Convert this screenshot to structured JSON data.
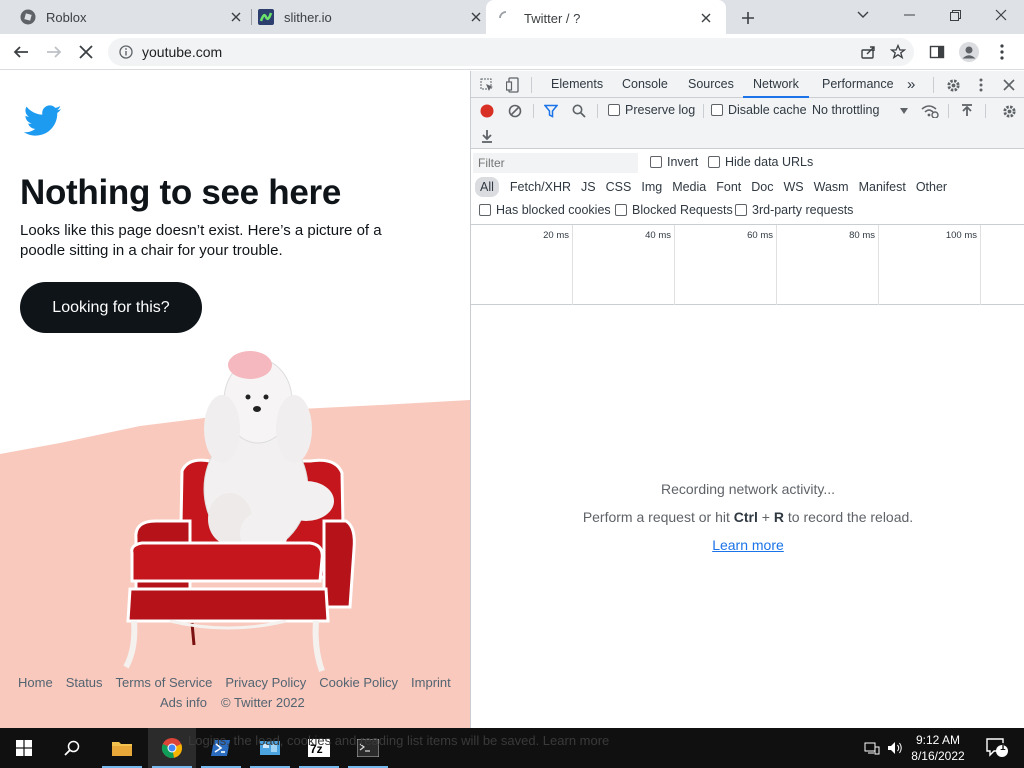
{
  "browser": {
    "tabs": [
      {
        "title": "Roblox",
        "icon": "roblox-icon"
      },
      {
        "title": "slither.io",
        "icon": "slither-icon"
      },
      {
        "title": "Twitter / ?",
        "icon": "loading-spinner-icon",
        "active": true
      }
    ],
    "address_bar": {
      "url": "youtube.com"
    }
  },
  "page": {
    "headline": "Nothing to see here",
    "subtext": "Looks like this page doesn’t exist. Here’s a picture of a poodle sitting in a chair for your trouble.",
    "cta_label": "Looking for this?",
    "footer_links": [
      "Home",
      "Status",
      "Terms of Service",
      "Privacy Policy",
      "Cookie Policy",
      "Imprint"
    ],
    "footer_links_row2": [
      "Ads info"
    ],
    "copyright": "© Twitter 2022",
    "colors": {
      "brand_blue": "#1d9bf0",
      "pink": "#f9c9bd",
      "chair_red": "#c4161c"
    }
  },
  "devtools": {
    "tabs": [
      "Elements",
      "Console",
      "Sources",
      "Network",
      "Performance"
    ],
    "active_tab": "Network",
    "more_tabs": "»",
    "controls": {
      "preserve_log": "Preserve log",
      "disable_cache": "Disable cache",
      "throttling": "No throttling"
    },
    "filter": {
      "placeholder": "Filter",
      "invert": "Invert",
      "hide_data_urls": "Hide data URLs"
    },
    "types": [
      "All",
      "Fetch/XHR",
      "JS",
      "CSS",
      "Img",
      "Media",
      "Font",
      "Doc",
      "WS",
      "Wasm",
      "Manifest",
      "Other"
    ],
    "options": {
      "blocked_cookies": "Has blocked cookies",
      "blocked_requests": "Blocked Requests",
      "third_party": "3rd-party requests"
    },
    "timeline_ticks": [
      "20 ms",
      "40 ms",
      "60 ms",
      "80 ms",
      "100 ms"
    ],
    "empty_state": {
      "recording": "Recording network activity...",
      "perform_prefix": "Perform a request or hit",
      "key_ctrl": "Ctrl",
      "plus": "+",
      "key_r": "R",
      "perform_suffix": "to record the reload.",
      "learn_more": "Learn more"
    }
  },
  "taskbar": {
    "ghost_text": "Logins, the load, cookies and reading list items will be saved. Learn more",
    "time": "9:12 AM",
    "date": "8/16/2022",
    "notification_count": "1"
  }
}
